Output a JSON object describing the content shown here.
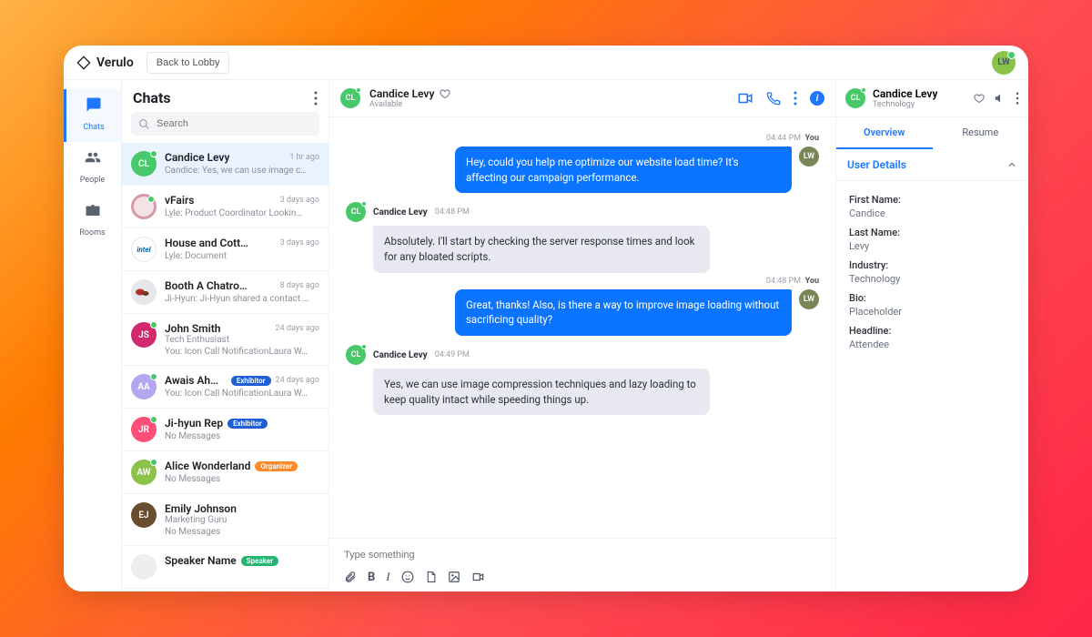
{
  "brand": "Verulo",
  "back_to_lobby": "Back to Lobby",
  "top_avatar": "LW",
  "nav": {
    "chats": "Chats",
    "people": "People",
    "rooms": "Rooms"
  },
  "chatlist": {
    "title": "Chats",
    "search_placeholder": "Search",
    "items": [
      {
        "initials": "CL",
        "bg": "#47c869",
        "name": "Candice Levy",
        "time": "1 hr ago",
        "preview": "Candice: Yes, we can use image c…"
      },
      {
        "initials": "",
        "bg": "#e9c7cf",
        "name": "vFairs",
        "time": "3 days ago",
        "preview": "Lyle: Product Coordinator Lookin…",
        "ring": true
      },
      {
        "initials": "intel",
        "bg": "#ffffff",
        "name": "House and Cott…",
        "time": "3 days ago",
        "preview": "Lyle: Document",
        "logo": "intel"
      },
      {
        "initials": "",
        "bg": "#e5e7ea",
        "name": "Booth A Chatro…",
        "time": "8 days ago",
        "preview": "Ji-Hyun: Ji-Hyun shared a contact …",
        "cars": true
      },
      {
        "initials": "JS",
        "bg": "#d12b6d",
        "name": "John Smith",
        "time": "24 days ago",
        "sub": "Tech Enthusiast",
        "preview": "You: Icon Call NotificationLaura W…"
      },
      {
        "initials": "AA",
        "bg": "#b4a7ef",
        "name": "Awais Ahmed",
        "badge": "Exhibitor",
        "badgeColor": "#1e5fd6",
        "time": "24 days ago",
        "preview": "You: Icon Call NotificationLaura W…"
      },
      {
        "initials": "JR",
        "bg": "#ff4f78",
        "name": "Ji-hyun Rep",
        "badge": "Exhibitor",
        "badgeColor": "#1e5fd6",
        "time": "",
        "preview": "No Messages"
      },
      {
        "initials": "AW",
        "bg": "#8bc34a",
        "name": "Alice Wonderland",
        "badge": "Organizer",
        "badgeColor": "#ff8a2a",
        "time": "",
        "preview": "No Messages"
      },
      {
        "initials": "EJ",
        "bg": "#6b4e2f",
        "name": "Emily Johnson",
        "time": "",
        "sub": "Marketing Guru",
        "preview": "No Messages"
      },
      {
        "initials": "",
        "bg": "#eee",
        "name": "Speaker Name",
        "badge": "Speaker",
        "badgeColor": "#22b573",
        "time": "",
        "preview": ""
      }
    ]
  },
  "conv": {
    "name": "Candice Levy",
    "status": "Available",
    "messages": [
      {
        "side": "right",
        "meta": "04:44 PM",
        "who": "You",
        "text": "Hey, could you help me optimize our website load time? It's affecting our campaign performance."
      },
      {
        "side": "left",
        "name": "Candice Levy",
        "meta": "04:48 PM",
        "text": "Absolutely. I'll start by checking the server response times and look for any bloated scripts."
      },
      {
        "side": "right",
        "meta": "04:48 PM",
        "who": "You",
        "text": "Great, thanks! Also, is there a way to improve image loading without sacrificing quality?"
      },
      {
        "side": "left",
        "name": "Candice Levy",
        "meta": "04:49 PM",
        "text": "Yes, we can use image compression techniques and lazy loading to keep quality intact while speeding things up."
      }
    ],
    "composer_placeholder": "Type something"
  },
  "right": {
    "name": "Candice Levy",
    "sub": "Technology",
    "tabs": {
      "overview": "Overview",
      "resume": "Resume"
    },
    "section": "User Details",
    "fields": {
      "first_name_label": "First Name:",
      "first_name": "Candice",
      "last_name_label": "Last Name:",
      "last_name": "Levy",
      "industry_label": "Industry:",
      "industry": "Technology",
      "bio_label": "Bio:",
      "bio": "Placeholder",
      "headline_label": "Headline:",
      "headline": "Attendee"
    }
  }
}
